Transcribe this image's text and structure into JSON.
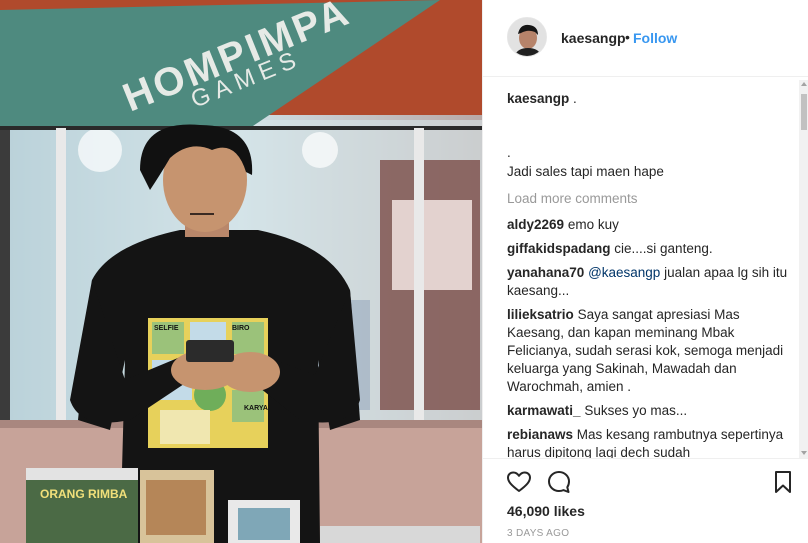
{
  "post": {
    "username": "kaesangp",
    "follow_label": "Follow",
    "dot": "•",
    "caption_user": "kaesangp",
    "caption_line1": ".",
    "caption_line2": ".",
    "caption_line3": "Jadi sales tapi maen hape",
    "load_more": "Load more comments",
    "likes_count": "46,090",
    "likes_label": "likes",
    "timestamp": "3 DAYS AGO"
  },
  "photo": {
    "sign_line1": "HOMPIMPA",
    "sign_line2": "GAMES",
    "box_title": "ORANG RIMBA",
    "shirt_words": [
      "SELFIE",
      "BIRO",
      "KARYA"
    ]
  },
  "comments": [
    {
      "user": "aldy2269",
      "mention": "",
      "text": "emo kuy"
    },
    {
      "user": "giffakidspadang",
      "mention": "",
      "text": "cie....si ganteng."
    },
    {
      "user": "yanahana70",
      "mention": "@kaesangp",
      "text": "jualan apaa lg sih itu kaesang..."
    },
    {
      "user": "lilieksatrio",
      "mention": "",
      "text": "Saya sangat apresiasi Mas Kaesang, dan kapan meminang Mbak Felicianya, sudah serasi kok, semoga menjadi keluarga yang Sakinah, Mawadah dan Warochmah, amien ."
    },
    {
      "user": "karmawati_",
      "mention": "",
      "text": "Sukses yo mas..."
    },
    {
      "user": "rebianaws",
      "mention": "",
      "text": "Mas kesang rambutnya sepertinya harus dipitong lagi dech sudah"
    }
  ],
  "icons": {
    "like": "heart-icon",
    "comment": "comment-bubble-icon",
    "save": "bookmark-icon"
  },
  "colors": {
    "link_blue": "#3897f0",
    "mention": "#003569",
    "muted": "#999999",
    "sign_green": "#4e8a7f",
    "sign_rust": "#b04a2c"
  }
}
